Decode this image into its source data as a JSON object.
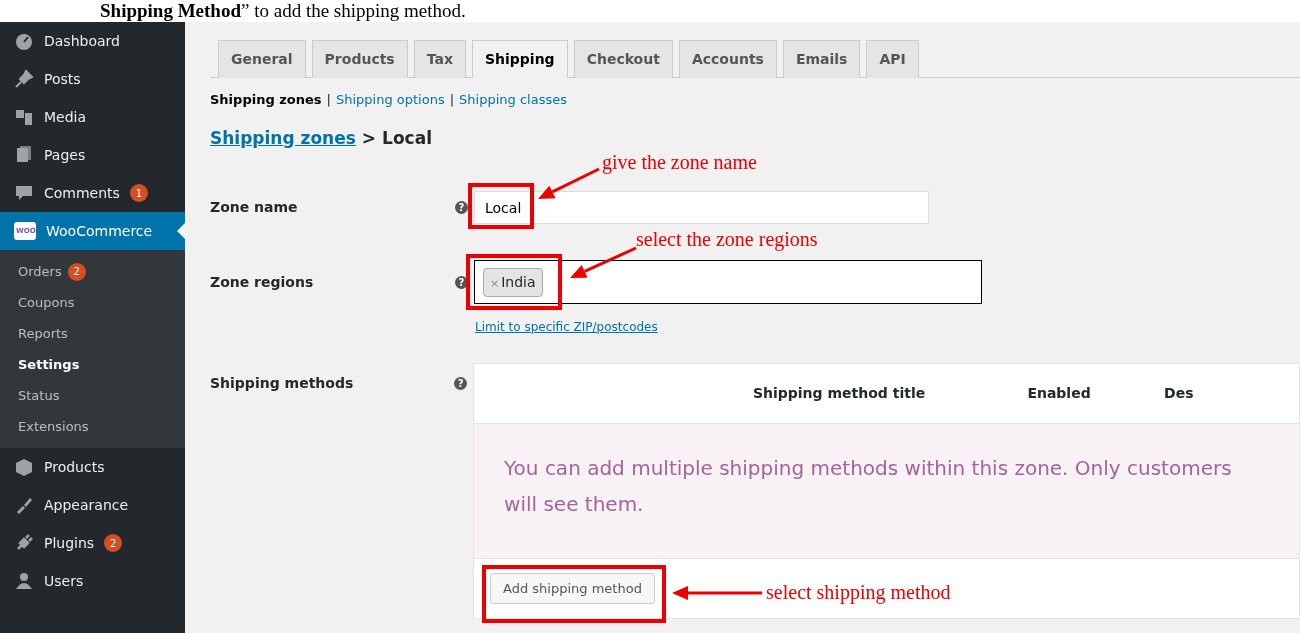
{
  "caption": "**Shipping Method**” to add the shipping method.",
  "sidebar": {
    "items": [
      {
        "label": "Dashboard",
        "kind": "gauge",
        "selected": false
      },
      {
        "label": "Posts",
        "kind": "pin",
        "selected": false
      },
      {
        "label": "Media",
        "kind": "media",
        "selected": false
      },
      {
        "label": "Pages",
        "kind": "pages",
        "selected": false
      },
      {
        "label": "Comments",
        "kind": "comment",
        "badge": "1",
        "selected": false
      },
      {
        "label": "WooCommerce",
        "kind": "woo",
        "icon_text": "WOO",
        "selected": true,
        "children": [
          {
            "label": "Orders",
            "badge": "2",
            "selected": false
          },
          {
            "label": "Coupons",
            "selected": false
          },
          {
            "label": "Reports",
            "selected": false
          },
          {
            "label": "Settings",
            "selected": true
          },
          {
            "label": "Status",
            "selected": false
          },
          {
            "label": "Extensions",
            "selected": false
          }
        ]
      },
      {
        "label": "Products",
        "kind": "box",
        "selected": false
      },
      {
        "label": "Appearance",
        "kind": "brush",
        "selected": false
      },
      {
        "label": "Plugins",
        "kind": "plug",
        "badge": "2",
        "selected": false
      },
      {
        "label": "Users",
        "kind": "user",
        "selected": false
      }
    ]
  },
  "tabs": [
    {
      "label": "General",
      "selected": false
    },
    {
      "label": "Products",
      "selected": false
    },
    {
      "label": "Tax",
      "selected": false
    },
    {
      "label": "Shipping",
      "selected": true
    },
    {
      "label": "Checkout",
      "selected": false
    },
    {
      "label": "Accounts",
      "selected": false
    },
    {
      "label": "Emails",
      "selected": false
    },
    {
      "label": "API",
      "selected": false
    }
  ],
  "subnav": [
    {
      "label": "Shipping zones",
      "selected": true
    },
    {
      "separator": "|",
      "label": "Shipping options",
      "selected": false
    },
    {
      "separator": "|",
      "label": "Shipping classes",
      "selected": false
    }
  ],
  "breadcrumb": {
    "link": "Shipping zones",
    "separator": ">",
    "current": "Local"
  },
  "zone_name": {
    "label": "Zone name",
    "help": "?",
    "value": "Local"
  },
  "zone_regions": {
    "label": "Zone regions",
    "help": "?",
    "tags": [
      {
        "remove": "×",
        "label": "India"
      }
    ]
  },
  "postcode_link": "Limit to specific ZIP/postcodes",
  "shipping_methods": {
    "label": "Shipping methods",
    "help": "?",
    "columns": [
      "Shipping method title",
      "Enabled",
      "Des"
    ],
    "message_lines": [
      "You can add multiple shipping methods within this zone. Only customers",
      "will see them."
    ],
    "add_button": "Add shipping method"
  },
  "annotations": [
    {
      "text": "give the zone name"
    },
    {
      "text": "select the zone regions"
    },
    {
      "text": "select shipping method"
    }
  ]
}
